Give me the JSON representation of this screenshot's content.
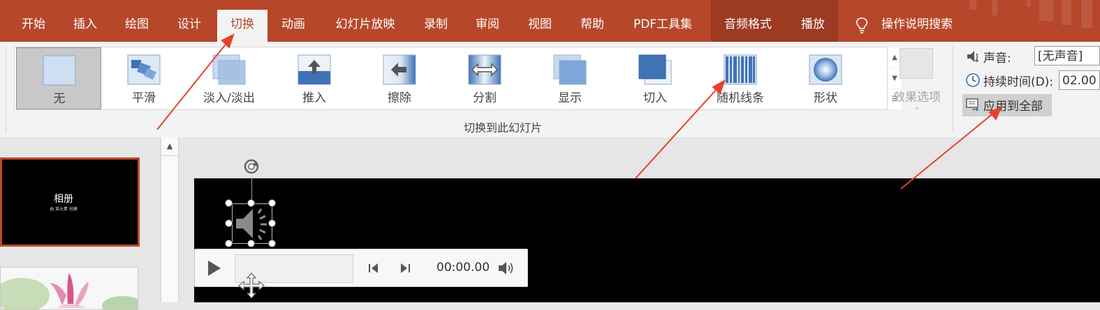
{
  "tabs": [
    {
      "label": "开始"
    },
    {
      "label": "插入"
    },
    {
      "label": "绘图"
    },
    {
      "label": "设计"
    },
    {
      "label": "切换",
      "active": true
    },
    {
      "label": "动画"
    },
    {
      "label": "幻灯片放映"
    },
    {
      "label": "录制"
    },
    {
      "label": "审阅"
    },
    {
      "label": "视图"
    },
    {
      "label": "帮助"
    },
    {
      "label": "PDF工具集"
    },
    {
      "label": "音频格式"
    },
    {
      "label": "播放"
    }
  ],
  "tell_me": {
    "label": "操作说明搜索",
    "icon": "lightbulb-icon"
  },
  "transitions": {
    "items": [
      {
        "label": "无",
        "icon": "none-transition-icon",
        "selected": true
      },
      {
        "label": "平滑",
        "icon": "morph-transition-icon"
      },
      {
        "label": "淡入/淡出",
        "icon": "fade-transition-icon"
      },
      {
        "label": "推入",
        "icon": "push-transition-icon"
      },
      {
        "label": "擦除",
        "icon": "wipe-transition-icon"
      },
      {
        "label": "分割",
        "icon": "split-transition-icon"
      },
      {
        "label": "显示",
        "icon": "reveal-transition-icon"
      },
      {
        "label": "切入",
        "icon": "cut-transition-icon"
      },
      {
        "label": "随机线条",
        "icon": "random-bars-transition-icon"
      },
      {
        "label": "形状",
        "icon": "shape-transition-icon"
      }
    ],
    "effect_options": "效果选项",
    "group_label": "切换到此幻灯片"
  },
  "timing": {
    "sound_label": "声音:",
    "sound_value": "[无声音]",
    "duration_label": "持续时间(D):",
    "duration_value": "02.00",
    "apply_all_label": "应用到全部"
  },
  "slides": {
    "thumb1_title": "相册",
    "thumb1_subtitle": "由 某元素 创建"
  },
  "media": {
    "time": "00:00.00"
  },
  "colors": {
    "accent": "#b7472a",
    "tab_bar": "#b7472a",
    "arrow": "#e8402f",
    "selection": "#c0472b"
  }
}
